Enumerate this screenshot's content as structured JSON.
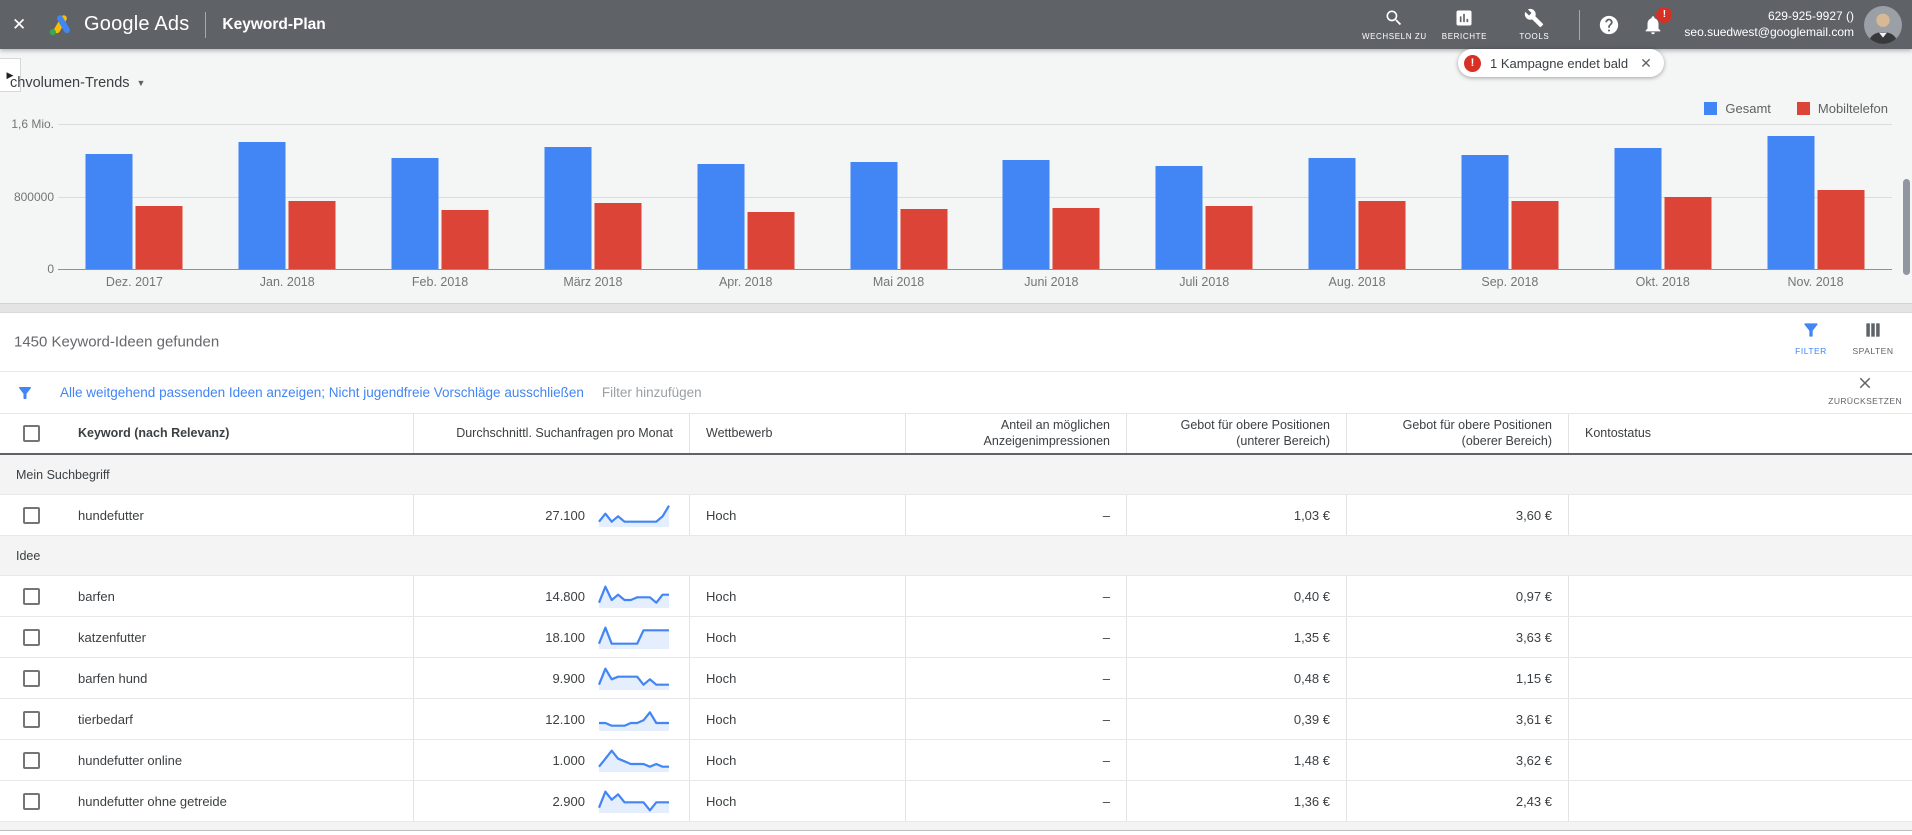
{
  "topbar": {
    "product": "Google Ads",
    "page_title": "Keyword-Plan",
    "close_label": "✕",
    "nav": {
      "switch_label": "WECHSELN ZU",
      "reports_label": "BERICHTE",
      "tools_label": "TOOLS"
    },
    "notification_count": "!",
    "account": {
      "phone": "629-925-9927 ()",
      "email": "seo.suedwest@googlemail.com"
    }
  },
  "toast": {
    "icon": "!",
    "text": "1 Kampagne endet bald",
    "close": "✕"
  },
  "chart": {
    "dropdown_label": "chvolumen-Trends",
    "y_ticks": [
      {
        "label": "1,6 Mio.",
        "value": 1600000
      },
      {
        "label": "800000",
        "value": 800000
      },
      {
        "label": "0",
        "value": 0
      }
    ]
  },
  "chart_data": {
    "type": "bar",
    "title": "Suchvolumen-Trends",
    "categories": [
      "Dez. 2017",
      "Jan. 2018",
      "Feb. 2018",
      "März 2018",
      "Apr. 2018",
      "Mai 2018",
      "Juni 2018",
      "Juli 2018",
      "Aug. 2018",
      "Sep. 2018",
      "Okt. 2018",
      "Nov. 2018"
    ],
    "series": [
      {
        "name": "Gesamt",
        "color": "#4285f4",
        "values": [
          1270000,
          1400000,
          1220000,
          1350000,
          1160000,
          1180000,
          1200000,
          1140000,
          1220000,
          1260000,
          1340000,
          1470000
        ]
      },
      {
        "name": "Mobiltelefon",
        "color": "#db4437",
        "values": [
          700000,
          750000,
          650000,
          730000,
          630000,
          660000,
          670000,
          690000,
          750000,
          750000,
          790000,
          870000
        ]
      }
    ],
    "ylim": [
      0,
      1600000
    ],
    "grid": true,
    "legend_position": "top-right"
  },
  "table": {
    "found_count": "1450 Keyword-Ideen gefunden",
    "filter_button": "FILTER",
    "columns_button": "SPALTEN",
    "filter_bar": {
      "applied": "Alle weitgehend passenden Ideen anzeigen; Nicht jugendfreie Vorschläge ausschließen",
      "add": "Filter hinzufügen",
      "reset": "ZURÜCKSETZEN"
    },
    "headers": [
      "Keyword (nach Relevanz)",
      "Durchschnittl. Suchanfragen pro Monat",
      "Wettbewerb",
      "Anteil an möglichen Anzeigenimpressionen",
      "Gebot für obere Positionen (unterer Bereich)",
      "Gebot für obere Positionen (oberer Bereich)",
      "Kontostatus"
    ],
    "sections": [
      {
        "label": "Mein Suchbegriff",
        "rows": [
          {
            "keyword": "hundefutter",
            "volume": "27.100",
            "spark": [
              2,
              5,
              2,
              4,
              2,
              2,
              2,
              2,
              2,
              2,
              4,
              8
            ],
            "competition": "Hoch",
            "impressions": "–",
            "bid_low": "1,03 €",
            "bid_high": "3,60 €",
            "status": ""
          }
        ]
      },
      {
        "label": "Idee",
        "rows": [
          {
            "keyword": "barfen",
            "volume": "14.800",
            "spark": [
              2,
              8,
              3,
              5,
              3,
              3,
              4,
              4,
              4,
              2,
              5,
              5
            ],
            "competition": "Hoch",
            "impressions": "–",
            "bid_low": "0,40 €",
            "bid_high": "0,97 €",
            "status": ""
          },
          {
            "keyword": "katzenfutter",
            "volume": "18.100",
            "spark": [
              2,
              8,
              2,
              2,
              2,
              2,
              2,
              7,
              7,
              7,
              7,
              7
            ],
            "competition": "Hoch",
            "impressions": "–",
            "bid_low": "1,35 €",
            "bid_high": "3,63 €",
            "status": ""
          },
          {
            "keyword": "barfen hund",
            "volume": "9.900",
            "spark": [
              2,
              8,
              4,
              5,
              5,
              5,
              5,
              2,
              4,
              2,
              2,
              2
            ],
            "competition": "Hoch",
            "impressions": "–",
            "bid_low": "0,48 €",
            "bid_high": "1,15 €",
            "status": ""
          },
          {
            "keyword": "tierbedarf",
            "volume": "12.100",
            "spark": [
              3,
              3,
              2,
              2,
              2,
              3,
              3,
              4,
              7,
              3,
              3,
              3
            ],
            "competition": "Hoch",
            "impressions": "–",
            "bid_low": "0,39 €",
            "bid_high": "3,61 €",
            "status": ""
          },
          {
            "keyword": "hundefutter online",
            "volume": "1.000",
            "spark": [
              2,
              5,
              8,
              5,
              4,
              3,
              3,
              3,
              2,
              3,
              2,
              2
            ],
            "competition": "Hoch",
            "impressions": "–",
            "bid_low": "1,48 €",
            "bid_high": "3,62 €",
            "status": ""
          },
          {
            "keyword": "hundefutter ohne getreide",
            "volume": "2.900",
            "spark": [
              2,
              8,
              5,
              7,
              4,
              4,
              4,
              4,
              1,
              4,
              4,
              4
            ],
            "competition": "Hoch",
            "impressions": "–",
            "bid_low": "1,36 €",
            "bid_high": "2,43 €",
            "status": ""
          }
        ]
      }
    ]
  }
}
